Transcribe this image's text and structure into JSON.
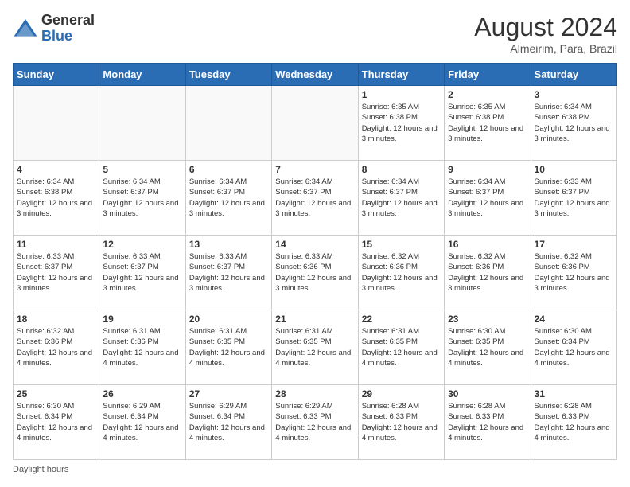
{
  "logo": {
    "general": "General",
    "blue": "Blue"
  },
  "header": {
    "month": "August 2024",
    "location": "Almeirim, Para, Brazil"
  },
  "days_of_week": [
    "Sunday",
    "Monday",
    "Tuesday",
    "Wednesday",
    "Thursday",
    "Friday",
    "Saturday"
  ],
  "footer": {
    "label": "Daylight hours"
  },
  "weeks": [
    [
      {
        "day": "",
        "sunrise": "",
        "sunset": "",
        "daylight": "",
        "empty": true
      },
      {
        "day": "",
        "sunrise": "",
        "sunset": "",
        "daylight": "",
        "empty": true
      },
      {
        "day": "",
        "sunrise": "",
        "sunset": "",
        "daylight": "",
        "empty": true
      },
      {
        "day": "",
        "sunrise": "",
        "sunset": "",
        "daylight": "",
        "empty": true
      },
      {
        "day": "1",
        "sunrise": "Sunrise: 6:35 AM",
        "sunset": "Sunset: 6:38 PM",
        "daylight": "Daylight: 12 hours and 3 minutes.",
        "empty": false
      },
      {
        "day": "2",
        "sunrise": "Sunrise: 6:35 AM",
        "sunset": "Sunset: 6:38 PM",
        "daylight": "Daylight: 12 hours and 3 minutes.",
        "empty": false
      },
      {
        "day": "3",
        "sunrise": "Sunrise: 6:34 AM",
        "sunset": "Sunset: 6:38 PM",
        "daylight": "Daylight: 12 hours and 3 minutes.",
        "empty": false
      }
    ],
    [
      {
        "day": "4",
        "sunrise": "Sunrise: 6:34 AM",
        "sunset": "Sunset: 6:38 PM",
        "daylight": "Daylight: 12 hours and 3 minutes.",
        "empty": false
      },
      {
        "day": "5",
        "sunrise": "Sunrise: 6:34 AM",
        "sunset": "Sunset: 6:37 PM",
        "daylight": "Daylight: 12 hours and 3 minutes.",
        "empty": false
      },
      {
        "day": "6",
        "sunrise": "Sunrise: 6:34 AM",
        "sunset": "Sunset: 6:37 PM",
        "daylight": "Daylight: 12 hours and 3 minutes.",
        "empty": false
      },
      {
        "day": "7",
        "sunrise": "Sunrise: 6:34 AM",
        "sunset": "Sunset: 6:37 PM",
        "daylight": "Daylight: 12 hours and 3 minutes.",
        "empty": false
      },
      {
        "day": "8",
        "sunrise": "Sunrise: 6:34 AM",
        "sunset": "Sunset: 6:37 PM",
        "daylight": "Daylight: 12 hours and 3 minutes.",
        "empty": false
      },
      {
        "day": "9",
        "sunrise": "Sunrise: 6:34 AM",
        "sunset": "Sunset: 6:37 PM",
        "daylight": "Daylight: 12 hours and 3 minutes.",
        "empty": false
      },
      {
        "day": "10",
        "sunrise": "Sunrise: 6:33 AM",
        "sunset": "Sunset: 6:37 PM",
        "daylight": "Daylight: 12 hours and 3 minutes.",
        "empty": false
      }
    ],
    [
      {
        "day": "11",
        "sunrise": "Sunrise: 6:33 AM",
        "sunset": "Sunset: 6:37 PM",
        "daylight": "Daylight: 12 hours and 3 minutes.",
        "empty": false
      },
      {
        "day": "12",
        "sunrise": "Sunrise: 6:33 AM",
        "sunset": "Sunset: 6:37 PM",
        "daylight": "Daylight: 12 hours and 3 minutes.",
        "empty": false
      },
      {
        "day": "13",
        "sunrise": "Sunrise: 6:33 AM",
        "sunset": "Sunset: 6:37 PM",
        "daylight": "Daylight: 12 hours and 3 minutes.",
        "empty": false
      },
      {
        "day": "14",
        "sunrise": "Sunrise: 6:33 AM",
        "sunset": "Sunset: 6:36 PM",
        "daylight": "Daylight: 12 hours and 3 minutes.",
        "empty": false
      },
      {
        "day": "15",
        "sunrise": "Sunrise: 6:32 AM",
        "sunset": "Sunset: 6:36 PM",
        "daylight": "Daylight: 12 hours and 3 minutes.",
        "empty": false
      },
      {
        "day": "16",
        "sunrise": "Sunrise: 6:32 AM",
        "sunset": "Sunset: 6:36 PM",
        "daylight": "Daylight: 12 hours and 3 minutes.",
        "empty": false
      },
      {
        "day": "17",
        "sunrise": "Sunrise: 6:32 AM",
        "sunset": "Sunset: 6:36 PM",
        "daylight": "Daylight: 12 hours and 3 minutes.",
        "empty": false
      }
    ],
    [
      {
        "day": "18",
        "sunrise": "Sunrise: 6:32 AM",
        "sunset": "Sunset: 6:36 PM",
        "daylight": "Daylight: 12 hours and 4 minutes.",
        "empty": false
      },
      {
        "day": "19",
        "sunrise": "Sunrise: 6:31 AM",
        "sunset": "Sunset: 6:36 PM",
        "daylight": "Daylight: 12 hours and 4 minutes.",
        "empty": false
      },
      {
        "day": "20",
        "sunrise": "Sunrise: 6:31 AM",
        "sunset": "Sunset: 6:35 PM",
        "daylight": "Daylight: 12 hours and 4 minutes.",
        "empty": false
      },
      {
        "day": "21",
        "sunrise": "Sunrise: 6:31 AM",
        "sunset": "Sunset: 6:35 PM",
        "daylight": "Daylight: 12 hours and 4 minutes.",
        "empty": false
      },
      {
        "day": "22",
        "sunrise": "Sunrise: 6:31 AM",
        "sunset": "Sunset: 6:35 PM",
        "daylight": "Daylight: 12 hours and 4 minutes.",
        "empty": false
      },
      {
        "day": "23",
        "sunrise": "Sunrise: 6:30 AM",
        "sunset": "Sunset: 6:35 PM",
        "daylight": "Daylight: 12 hours and 4 minutes.",
        "empty": false
      },
      {
        "day": "24",
        "sunrise": "Sunrise: 6:30 AM",
        "sunset": "Sunset: 6:34 PM",
        "daylight": "Daylight: 12 hours and 4 minutes.",
        "empty": false
      }
    ],
    [
      {
        "day": "25",
        "sunrise": "Sunrise: 6:30 AM",
        "sunset": "Sunset: 6:34 PM",
        "daylight": "Daylight: 12 hours and 4 minutes.",
        "empty": false
      },
      {
        "day": "26",
        "sunrise": "Sunrise: 6:29 AM",
        "sunset": "Sunset: 6:34 PM",
        "daylight": "Daylight: 12 hours and 4 minutes.",
        "empty": false
      },
      {
        "day": "27",
        "sunrise": "Sunrise: 6:29 AM",
        "sunset": "Sunset: 6:34 PM",
        "daylight": "Daylight: 12 hours and 4 minutes.",
        "empty": false
      },
      {
        "day": "28",
        "sunrise": "Sunrise: 6:29 AM",
        "sunset": "Sunset: 6:33 PM",
        "daylight": "Daylight: 12 hours and 4 minutes.",
        "empty": false
      },
      {
        "day": "29",
        "sunrise": "Sunrise: 6:28 AM",
        "sunset": "Sunset: 6:33 PM",
        "daylight": "Daylight: 12 hours and 4 minutes.",
        "empty": false
      },
      {
        "day": "30",
        "sunrise": "Sunrise: 6:28 AM",
        "sunset": "Sunset: 6:33 PM",
        "daylight": "Daylight: 12 hours and 4 minutes.",
        "empty": false
      },
      {
        "day": "31",
        "sunrise": "Sunrise: 6:28 AM",
        "sunset": "Sunset: 6:33 PM",
        "daylight": "Daylight: 12 hours and 4 minutes.",
        "empty": false
      }
    ]
  ]
}
